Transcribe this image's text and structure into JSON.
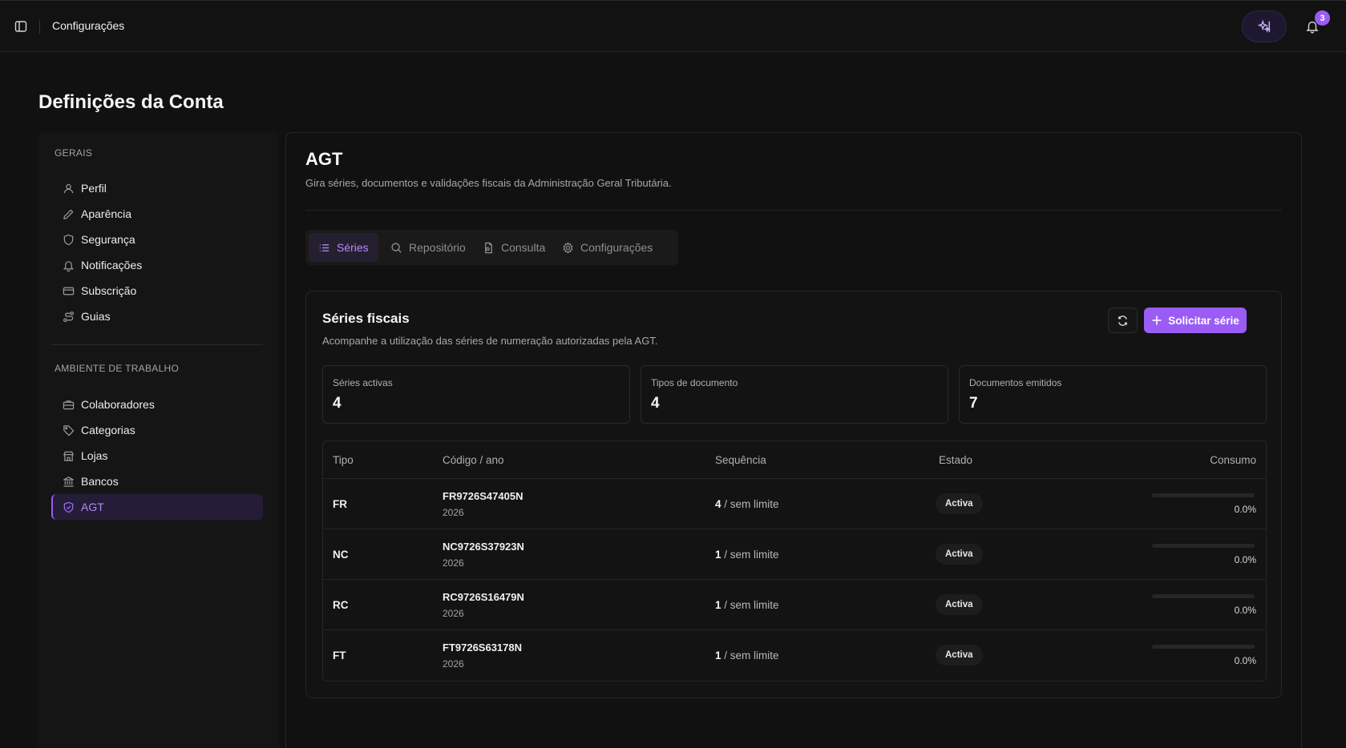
{
  "topbar": {
    "breadcrumb": "Configurações",
    "notifications_count": "3"
  },
  "page": {
    "title": "Definições da Conta"
  },
  "sidebar": {
    "sections": [
      {
        "label": "GERAIS"
      },
      {
        "label": "AMBIENTE DE TRABALHO"
      }
    ],
    "items": [
      {
        "label": "Perfil",
        "icon": "user-icon"
      },
      {
        "label": "Aparência",
        "icon": "pencil-icon"
      },
      {
        "label": "Segurança",
        "icon": "shield-icon"
      },
      {
        "label": "Notificações",
        "icon": "bell-icon"
      },
      {
        "label": "Subscrição",
        "icon": "credit-card-icon"
      },
      {
        "label": "Guias",
        "icon": "route-icon"
      },
      {
        "label": "Colaboradores",
        "icon": "briefcase-icon"
      },
      {
        "label": "Categorias",
        "icon": "tag-icon"
      },
      {
        "label": "Lojas",
        "icon": "store-icon"
      },
      {
        "label": "Bancos",
        "icon": "bank-icon"
      },
      {
        "label": "AGT",
        "icon": "shield-check-icon",
        "active": true
      }
    ]
  },
  "main": {
    "title": "AGT",
    "subtitle": "Gira séries, documentos e validações fiscais da Administração Geral Tributária.",
    "tabs": [
      {
        "label": "Séries",
        "icon": "list-icon",
        "active": true
      },
      {
        "label": "Repositório",
        "icon": "search-icon"
      },
      {
        "label": "Consulta",
        "icon": "document-search-icon"
      },
      {
        "label": "Configurações",
        "icon": "gear-icon"
      }
    ]
  },
  "series_card": {
    "title": "Séries fiscais",
    "description": "Acompanhe a utilização das séries de numeração autorizadas pela AGT.",
    "request_button": "Solicitar série",
    "stats": [
      {
        "label": "Séries activas",
        "value": "4"
      },
      {
        "label": "Tipos de documento",
        "value": "4"
      },
      {
        "label": "Documentos emitidos",
        "value": "7"
      }
    ],
    "columns": [
      "Tipo",
      "Código / ano",
      "Sequência",
      "Estado",
      "Consumo"
    ],
    "rows": [
      {
        "tipo": "FR",
        "codigo": "FR9726S47405N",
        "ano": "2026",
        "seq": "4",
        "limite": " / sem limite",
        "estado": "Activa",
        "consumo": "0.0%",
        "consumo_fraction": 0.0
      },
      {
        "tipo": "NC",
        "codigo": "NC9726S37923N",
        "ano": "2026",
        "seq": "1",
        "limite": " / sem limite",
        "estado": "Activa",
        "consumo": "0.0%",
        "consumo_fraction": 0.0
      },
      {
        "tipo": "RC",
        "codigo": "RC9726S16479N",
        "ano": "2026",
        "seq": "1",
        "limite": " / sem limite",
        "estado": "Activa",
        "consumo": "0.0%",
        "consumo_fraction": 0.0
      },
      {
        "tipo": "FT",
        "codigo": "FT9726S63178N",
        "ano": "2026",
        "seq": "1",
        "limite": " / sem limite",
        "estado": "Activa",
        "consumo": "0.0%",
        "consumo_fraction": 0.0
      }
    ]
  },
  "colors": {
    "accent": "#9b5cf6",
    "background": "#111111",
    "active_nav_bg": "#251d37"
  }
}
